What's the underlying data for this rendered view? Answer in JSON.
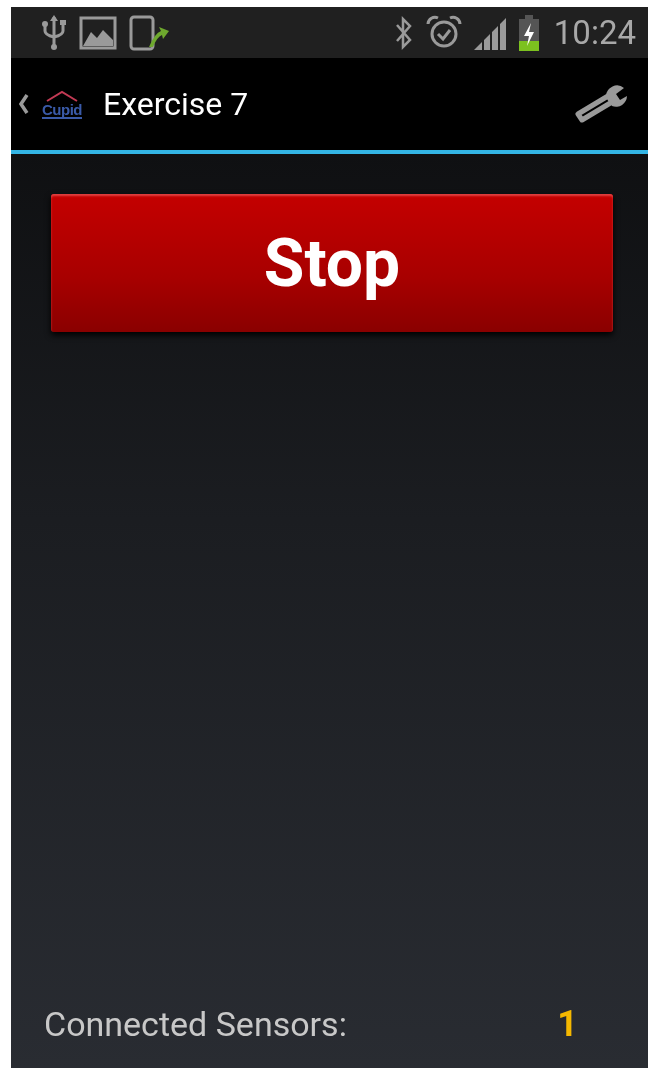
{
  "status_bar": {
    "time": "10:24"
  },
  "action_bar": {
    "logo": "Cupid",
    "title": "Exercise 7"
  },
  "stop_button": {
    "label": "Stop"
  },
  "footer": {
    "label": "Connected Sensors:",
    "value": "1"
  }
}
